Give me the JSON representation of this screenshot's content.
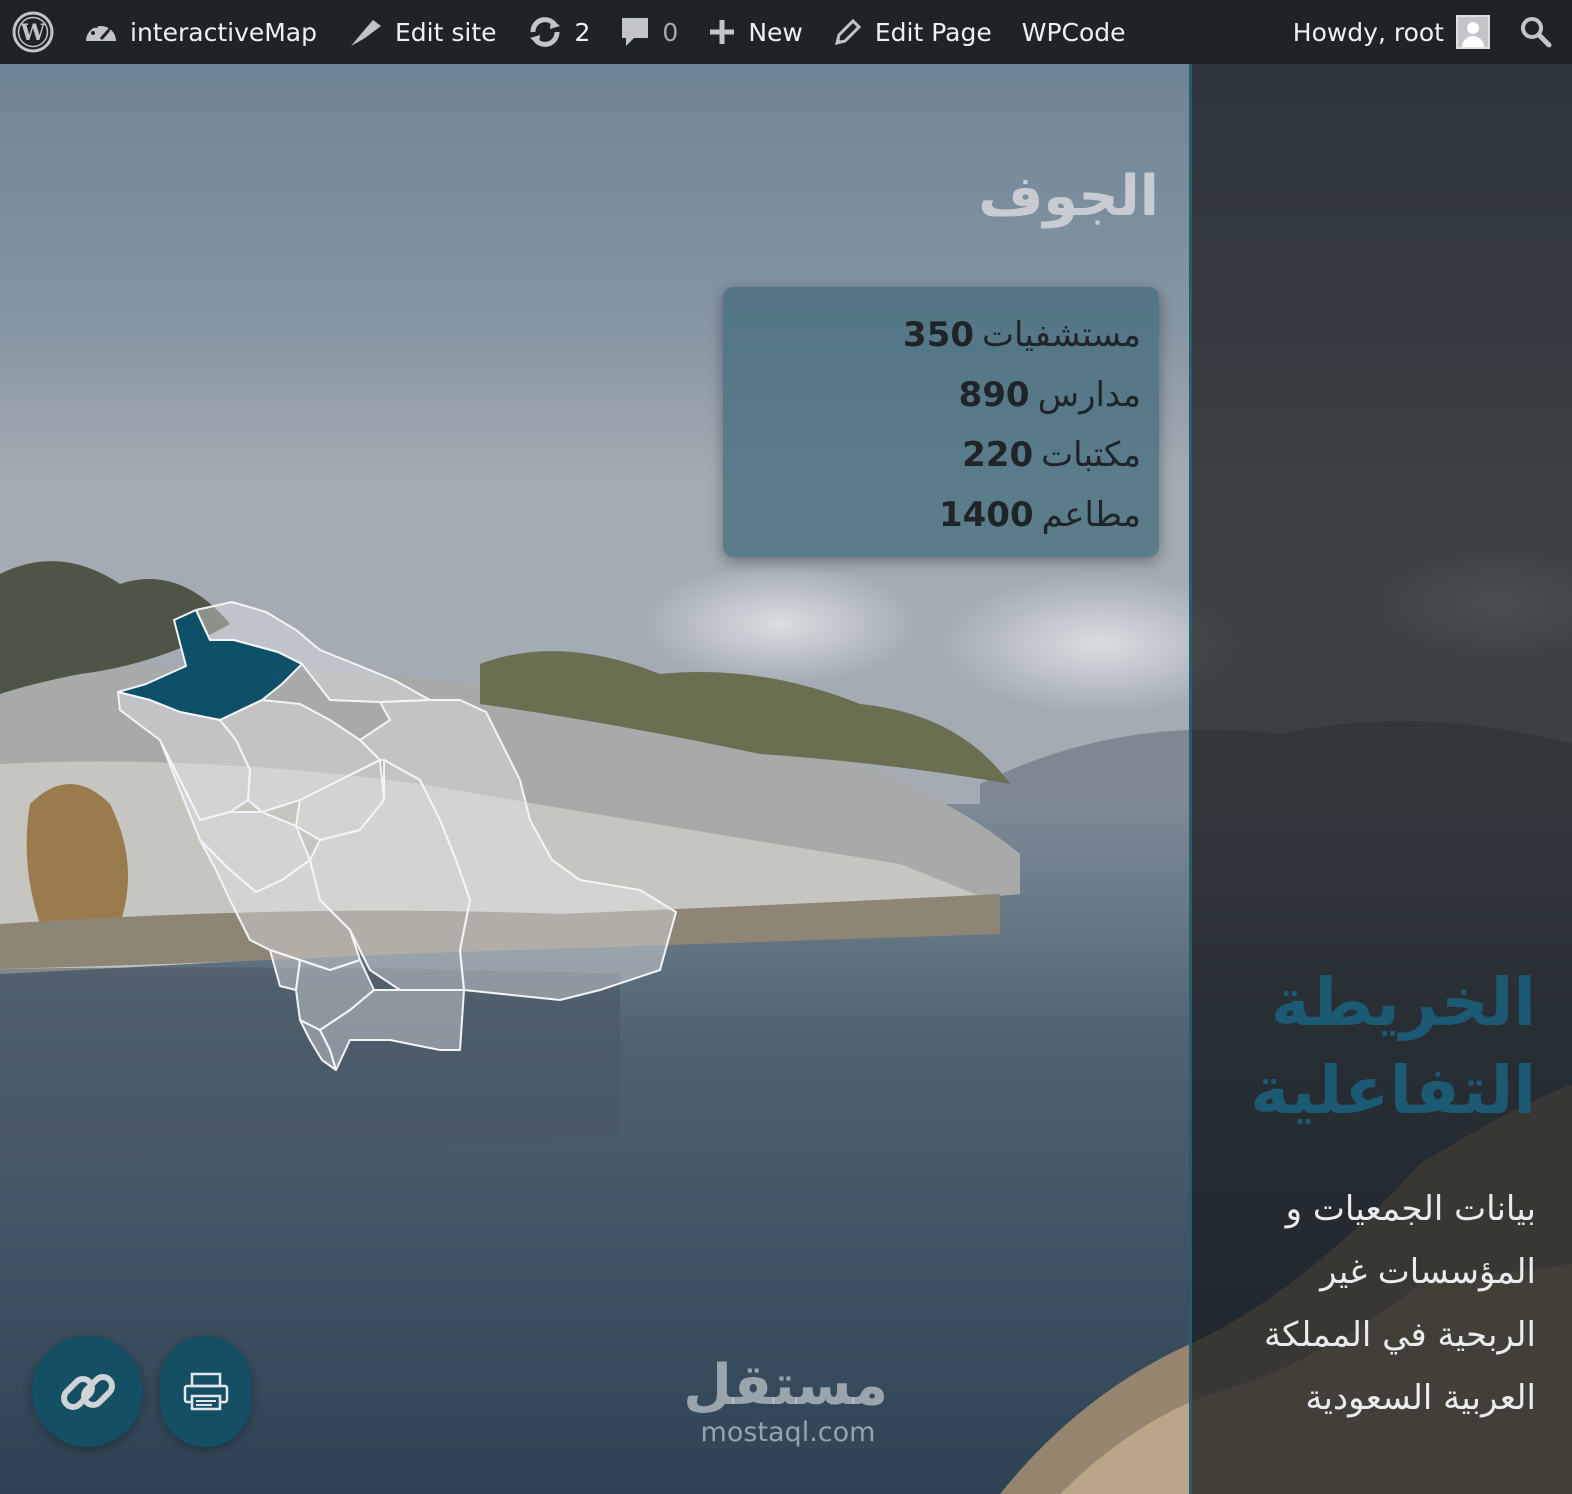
{
  "admin_bar": {
    "site_name": "interactiveMap",
    "edit_site": "Edit site",
    "updates_count": "2",
    "comments_count": "0",
    "new_label": "New",
    "edit_page": "Edit Page",
    "wpcode": "WPCode",
    "greeting": "Howdy, root"
  },
  "region": {
    "name": "الجوف",
    "stats": [
      {
        "label": "مستشفيات",
        "value": "350"
      },
      {
        "label": "مدارس",
        "value": "890"
      },
      {
        "label": "مكتبات",
        "value": "220"
      },
      {
        "label": "مطاعم",
        "value": "1400"
      }
    ]
  },
  "panel": {
    "title": "الخريطة التفاعلية",
    "description": "بيانات الجمعيات و المؤسسات غير الربحية في المملكة العربية السعودية"
  },
  "watermark": {
    "arabic": "مستقل",
    "latin": "mostaql.com"
  },
  "colors": {
    "accent": "#0f5069",
    "admin_bar": "#1d2327",
    "card": "#466e7d"
  }
}
